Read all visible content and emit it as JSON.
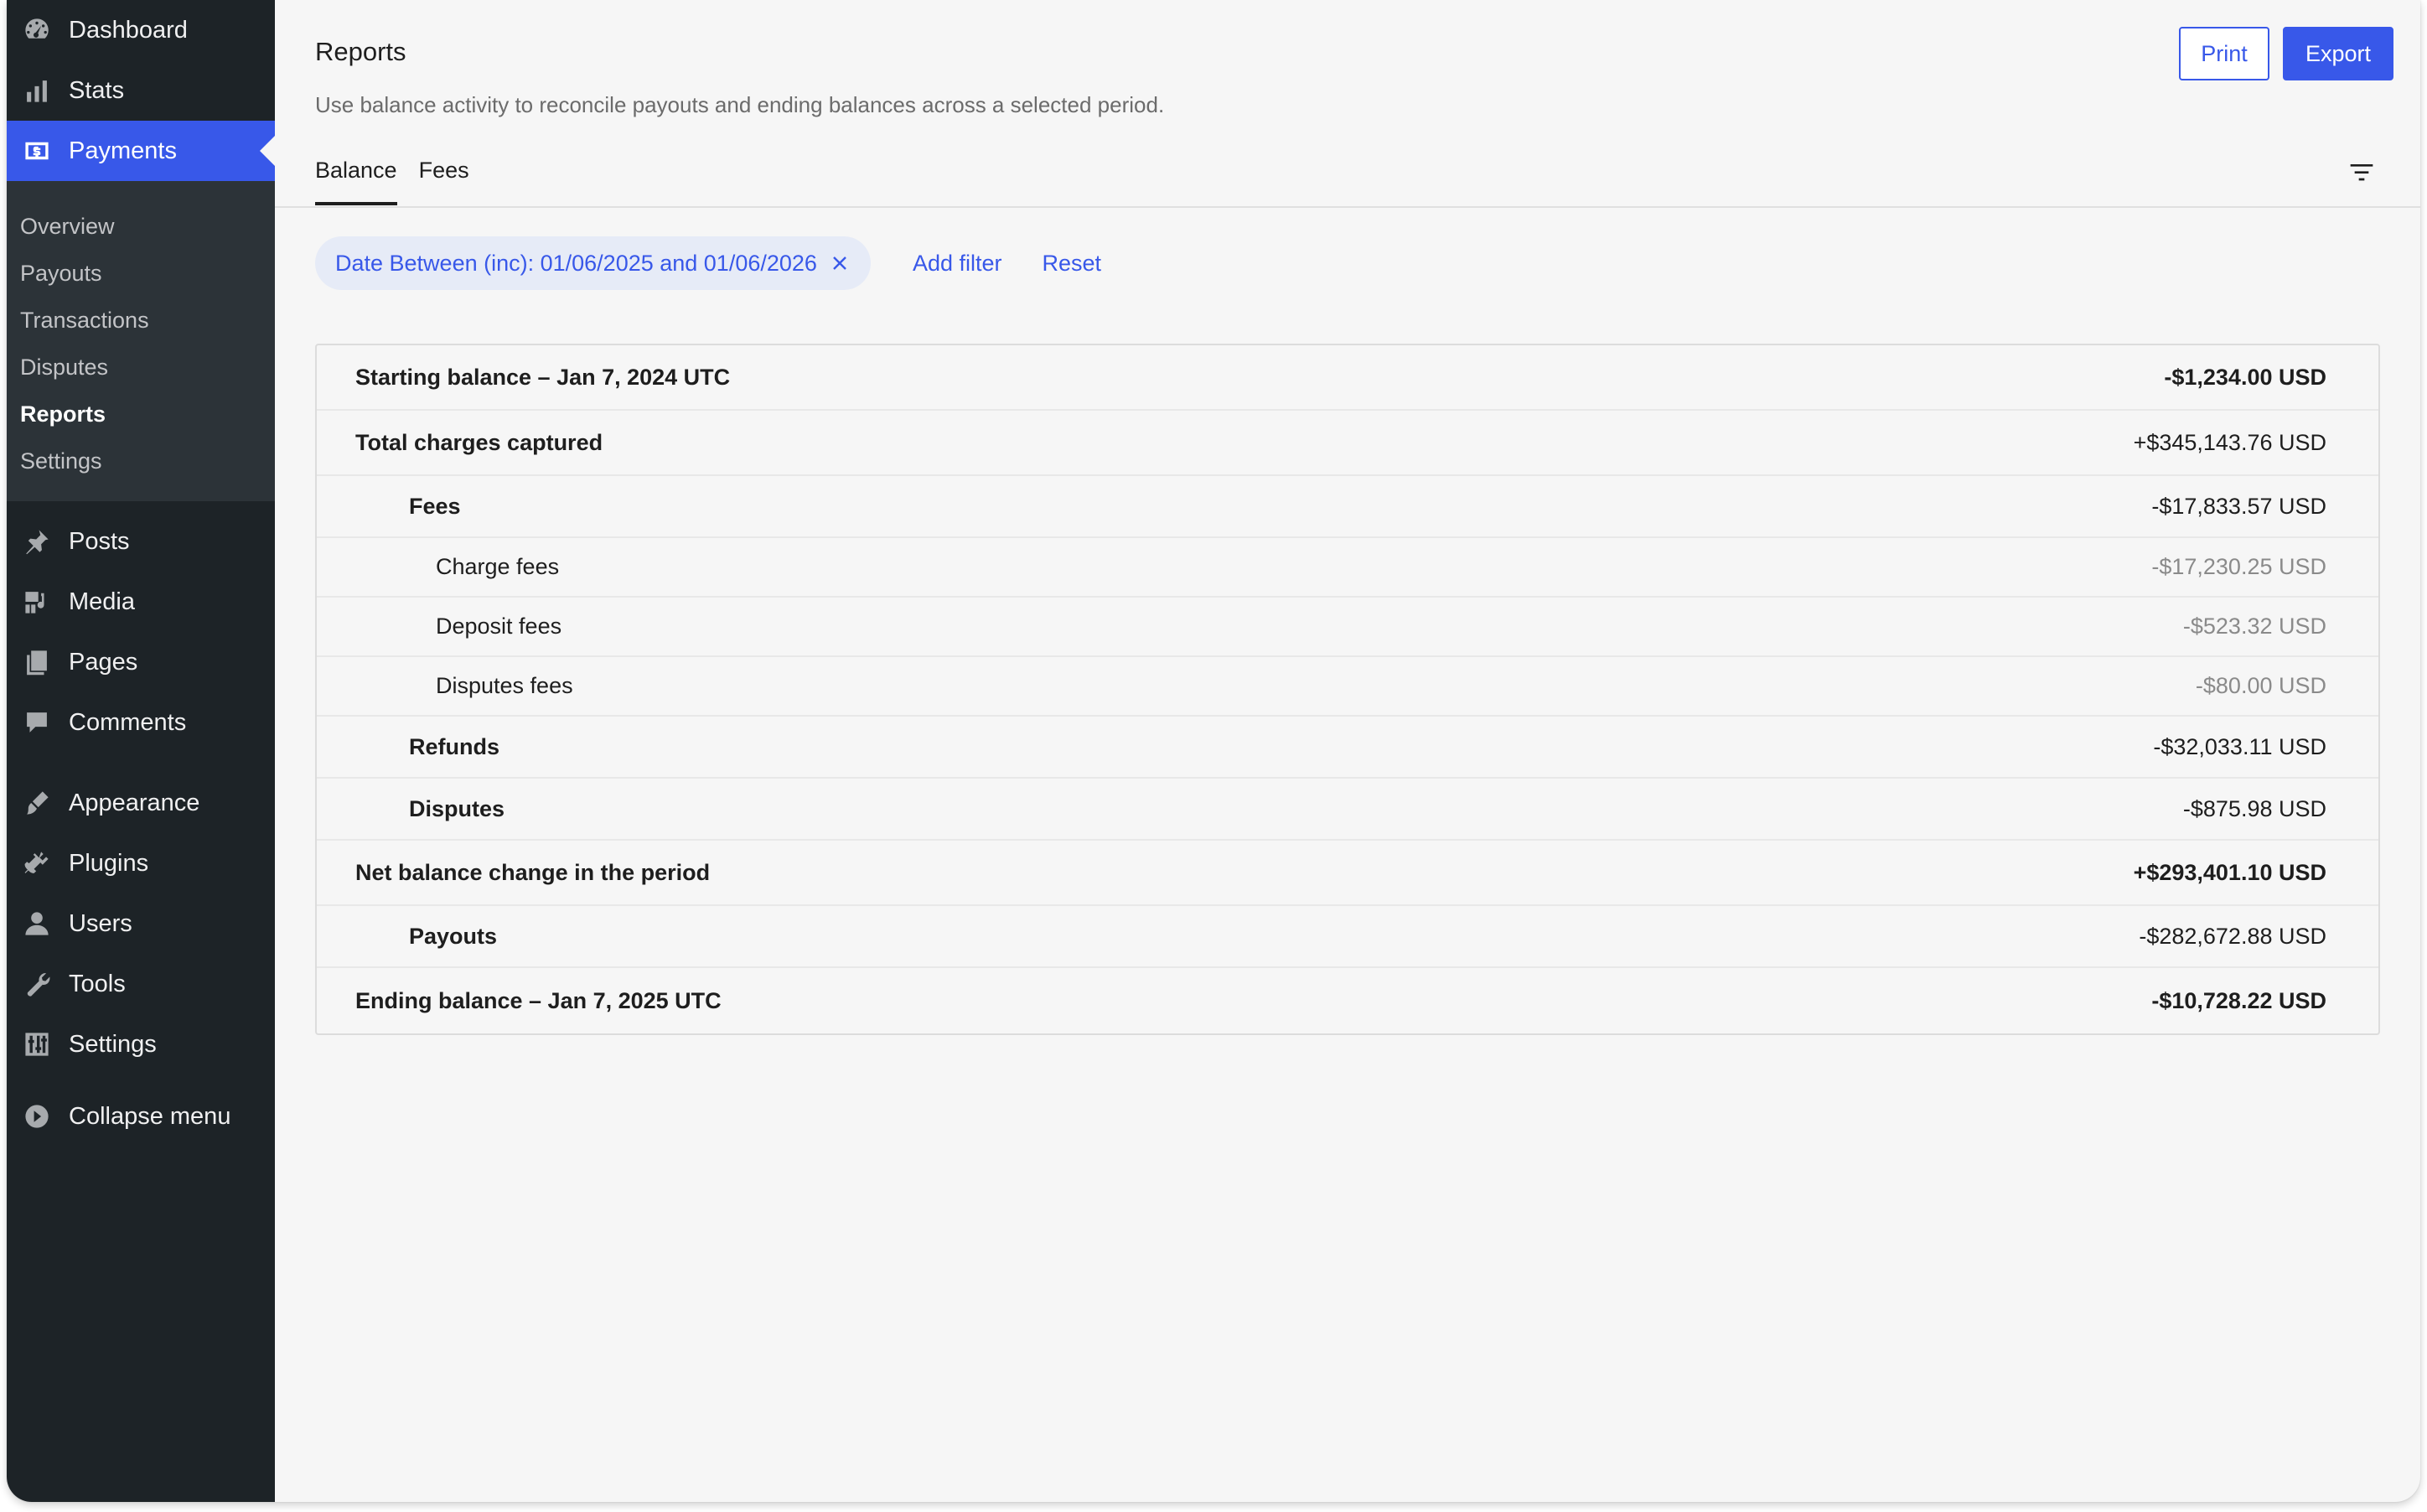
{
  "sidebar": {
    "top_items": [
      {
        "label": "Dashboard",
        "icon": "dashboard-icon"
      },
      {
        "label": "Stats",
        "icon": "stats-icon"
      },
      {
        "label": "Payments",
        "icon": "payments-icon",
        "active": true
      }
    ],
    "submenu": [
      {
        "label": "Overview"
      },
      {
        "label": "Payouts"
      },
      {
        "label": "Transactions"
      },
      {
        "label": "Disputes"
      },
      {
        "label": "Reports",
        "current": true
      },
      {
        "label": "Settings"
      }
    ],
    "content_items": [
      {
        "label": "Posts",
        "icon": "pin-icon"
      },
      {
        "label": "Media",
        "icon": "media-icon"
      },
      {
        "label": "Pages",
        "icon": "pages-icon"
      },
      {
        "label": "Comments",
        "icon": "comment-icon"
      }
    ],
    "admin_items": [
      {
        "label": "Appearance",
        "icon": "brush-icon"
      },
      {
        "label": "Plugins",
        "icon": "plugin-icon"
      },
      {
        "label": "Users",
        "icon": "user-icon"
      },
      {
        "label": "Tools",
        "icon": "wrench-icon"
      },
      {
        "label": "Settings",
        "icon": "settings-sliders-icon"
      }
    ],
    "collapse_label": "Collapse menu"
  },
  "header": {
    "title": "Reports",
    "description": "Use balance activity to reconcile payouts and ending balances across a selected period.",
    "print_label": "Print",
    "export_label": "Export"
  },
  "tabs": [
    {
      "label": "Balance",
      "active": true
    },
    {
      "label": "Fees"
    }
  ],
  "filters": {
    "chip_label": "Date Between (inc): 01/06/2025 and 01/06/2026",
    "add_filter_label": "Add filter",
    "reset_label": "Reset"
  },
  "report_rows": [
    {
      "label": "Starting balance – Jan 7, 2024 UTC",
      "amount": "-$1,234.00 USD",
      "level": 0
    },
    {
      "label": "Total charges captured",
      "amount": "+$345,143.76 USD",
      "level": 0,
      "amount_normal": true
    },
    {
      "label": "Fees",
      "amount": "-$17,833.57 USD",
      "level": 1
    },
    {
      "label": "Charge fees",
      "amount": "-$17,230.25 USD",
      "level": 2
    },
    {
      "label": "Deposit fees",
      "amount": "-$523.32 USD",
      "level": 2
    },
    {
      "label": "Disputes fees",
      "amount": "-$80.00 USD",
      "level": 2
    },
    {
      "label": "Refunds",
      "amount": "-$32,033.11 USD",
      "level": 1
    },
    {
      "label": "Disputes",
      "amount": "-$875.98 USD",
      "level": 1
    },
    {
      "label": "Net balance change in the period",
      "amount": "+$293,401.10 USD",
      "level": 0
    },
    {
      "label": "Payouts",
      "amount": "-$282,672.88 USD",
      "level": 1
    },
    {
      "label": "Ending balance – Jan 7, 2025 UTC",
      "amount": "-$10,728.22 USD",
      "level": 0
    }
  ],
  "colors": {
    "accent": "#3858e9",
    "sidebar_bg": "#1d2327",
    "submenu_bg": "#2c3338",
    "page_bg": "#f6f6f6"
  }
}
